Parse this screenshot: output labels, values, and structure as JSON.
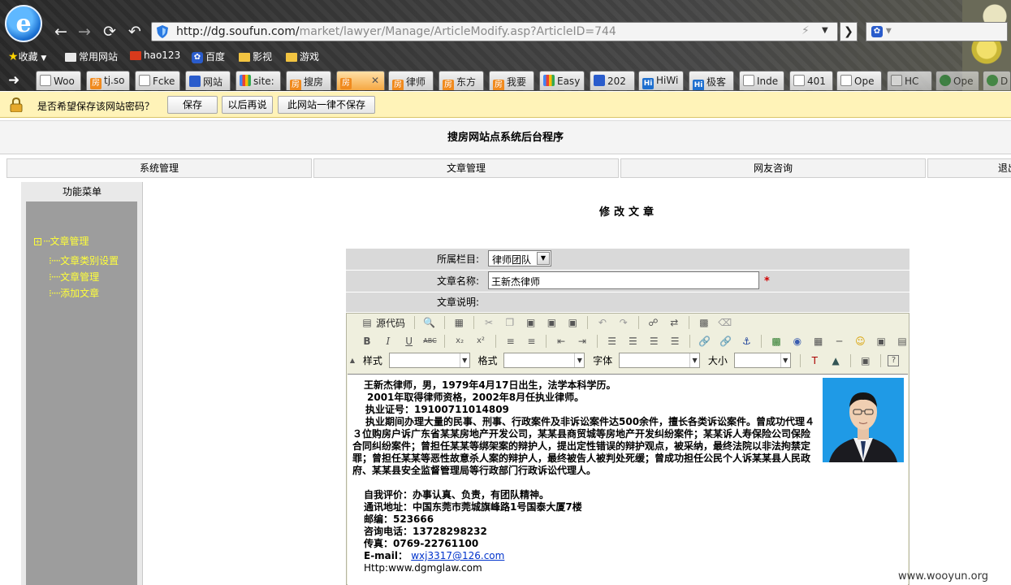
{
  "browser": {
    "url_host": "http://dg.soufun.com/",
    "url_path": "market/lawyer/Manage/ArticleModify.asp?ArticleID=744",
    "bookmarks": [
      {
        "label": "收藏"
      },
      {
        "label": "常用网站"
      },
      {
        "label": "hao123"
      },
      {
        "label": "百度"
      },
      {
        "label": "影视"
      },
      {
        "label": "游戏"
      }
    ],
    "tabs": [
      {
        "label": "Woo"
      },
      {
        "label": "tj.so"
      },
      {
        "label": "Fcke"
      },
      {
        "label": "网站"
      },
      {
        "label": "site:"
      },
      {
        "label": "搜房"
      },
      {
        "label": "房"
      },
      {
        "label": "律师"
      },
      {
        "label": "东方"
      },
      {
        "label": "我要"
      },
      {
        "label": "Easy"
      },
      {
        "label": "202"
      },
      {
        "label": "HiWi"
      },
      {
        "label": "极客"
      },
      {
        "label": "Inde"
      },
      {
        "label": "401"
      },
      {
        "label": "Ope"
      },
      {
        "label": "HC"
      },
      {
        "label": "Ope"
      },
      {
        "label": "D"
      }
    ],
    "password_bar": {
      "question": "是否希望保存该网站密码？",
      "save": "保存",
      "later": "以后再说",
      "never": "此网站一律不保存"
    }
  },
  "page": {
    "title": "搜房网站点系统后台程序",
    "nav": [
      "系统管理",
      "文章管理",
      "网友咨询",
      "退出"
    ],
    "sidebar": {
      "heading": "功能菜单",
      "root": "文章管理",
      "items": [
        "文章类别设置",
        "文章管理",
        "添加文章"
      ]
    },
    "form": {
      "title": "修改文章",
      "category_label": "所属栏目:",
      "category_value": "律师团队",
      "name_label": "文章名称:",
      "name_value": "王新杰律师",
      "required_mark": "*",
      "desc_label": "文章说明:"
    },
    "editor": {
      "source_label": "源代码",
      "style_label": "样式",
      "format_label": "格式",
      "font_label": "字体",
      "size_label": "大小",
      "content": {
        "line1": "王新杰律师，男，1979年4月17日出生，法学本科学历。",
        "line2": "2001年取得律师资格，2002年8月任执业律师。",
        "line3": "执业证号：19100711014809",
        "para": "执业期间办理大量的民事、刑事、行政案件及非诉讼案件达500余件，擅长各类诉讼案件。曾成功代理４３位购房户诉广东省某某房地产开发公司，某某县商贸城等房地产开发纠纷案件；某某诉人寿保险公司保险合同纠纷案件；曾担任某某等绑架案的辩护人，提出定性错误的辩护观点，被采纳，最终法院以非法拘禁定罪；曾担任某某等恶性故意杀人案的辩护人，最终被告人被判处死缓；曾成功担任公民个人诉某某县人民政府、某某县安全监督管理局等行政部门行政诉讼代理人。",
        "eval": "自我评价：办事认真、负责，有团队精神。",
        "address": "通讯地址：中国东莞市莞城旗峰路1号国泰大厦7楼",
        "postcode": "邮编：523666",
        "phone": "咨询电话：13728298232",
        "fax": "传真：0769-22761100",
        "email_label": "E-mail：",
        "email": "wxj3317@126.com",
        "website": "Http:www.dgmglaw.com"
      }
    }
  },
  "watermark": "www.wooyun.org"
}
